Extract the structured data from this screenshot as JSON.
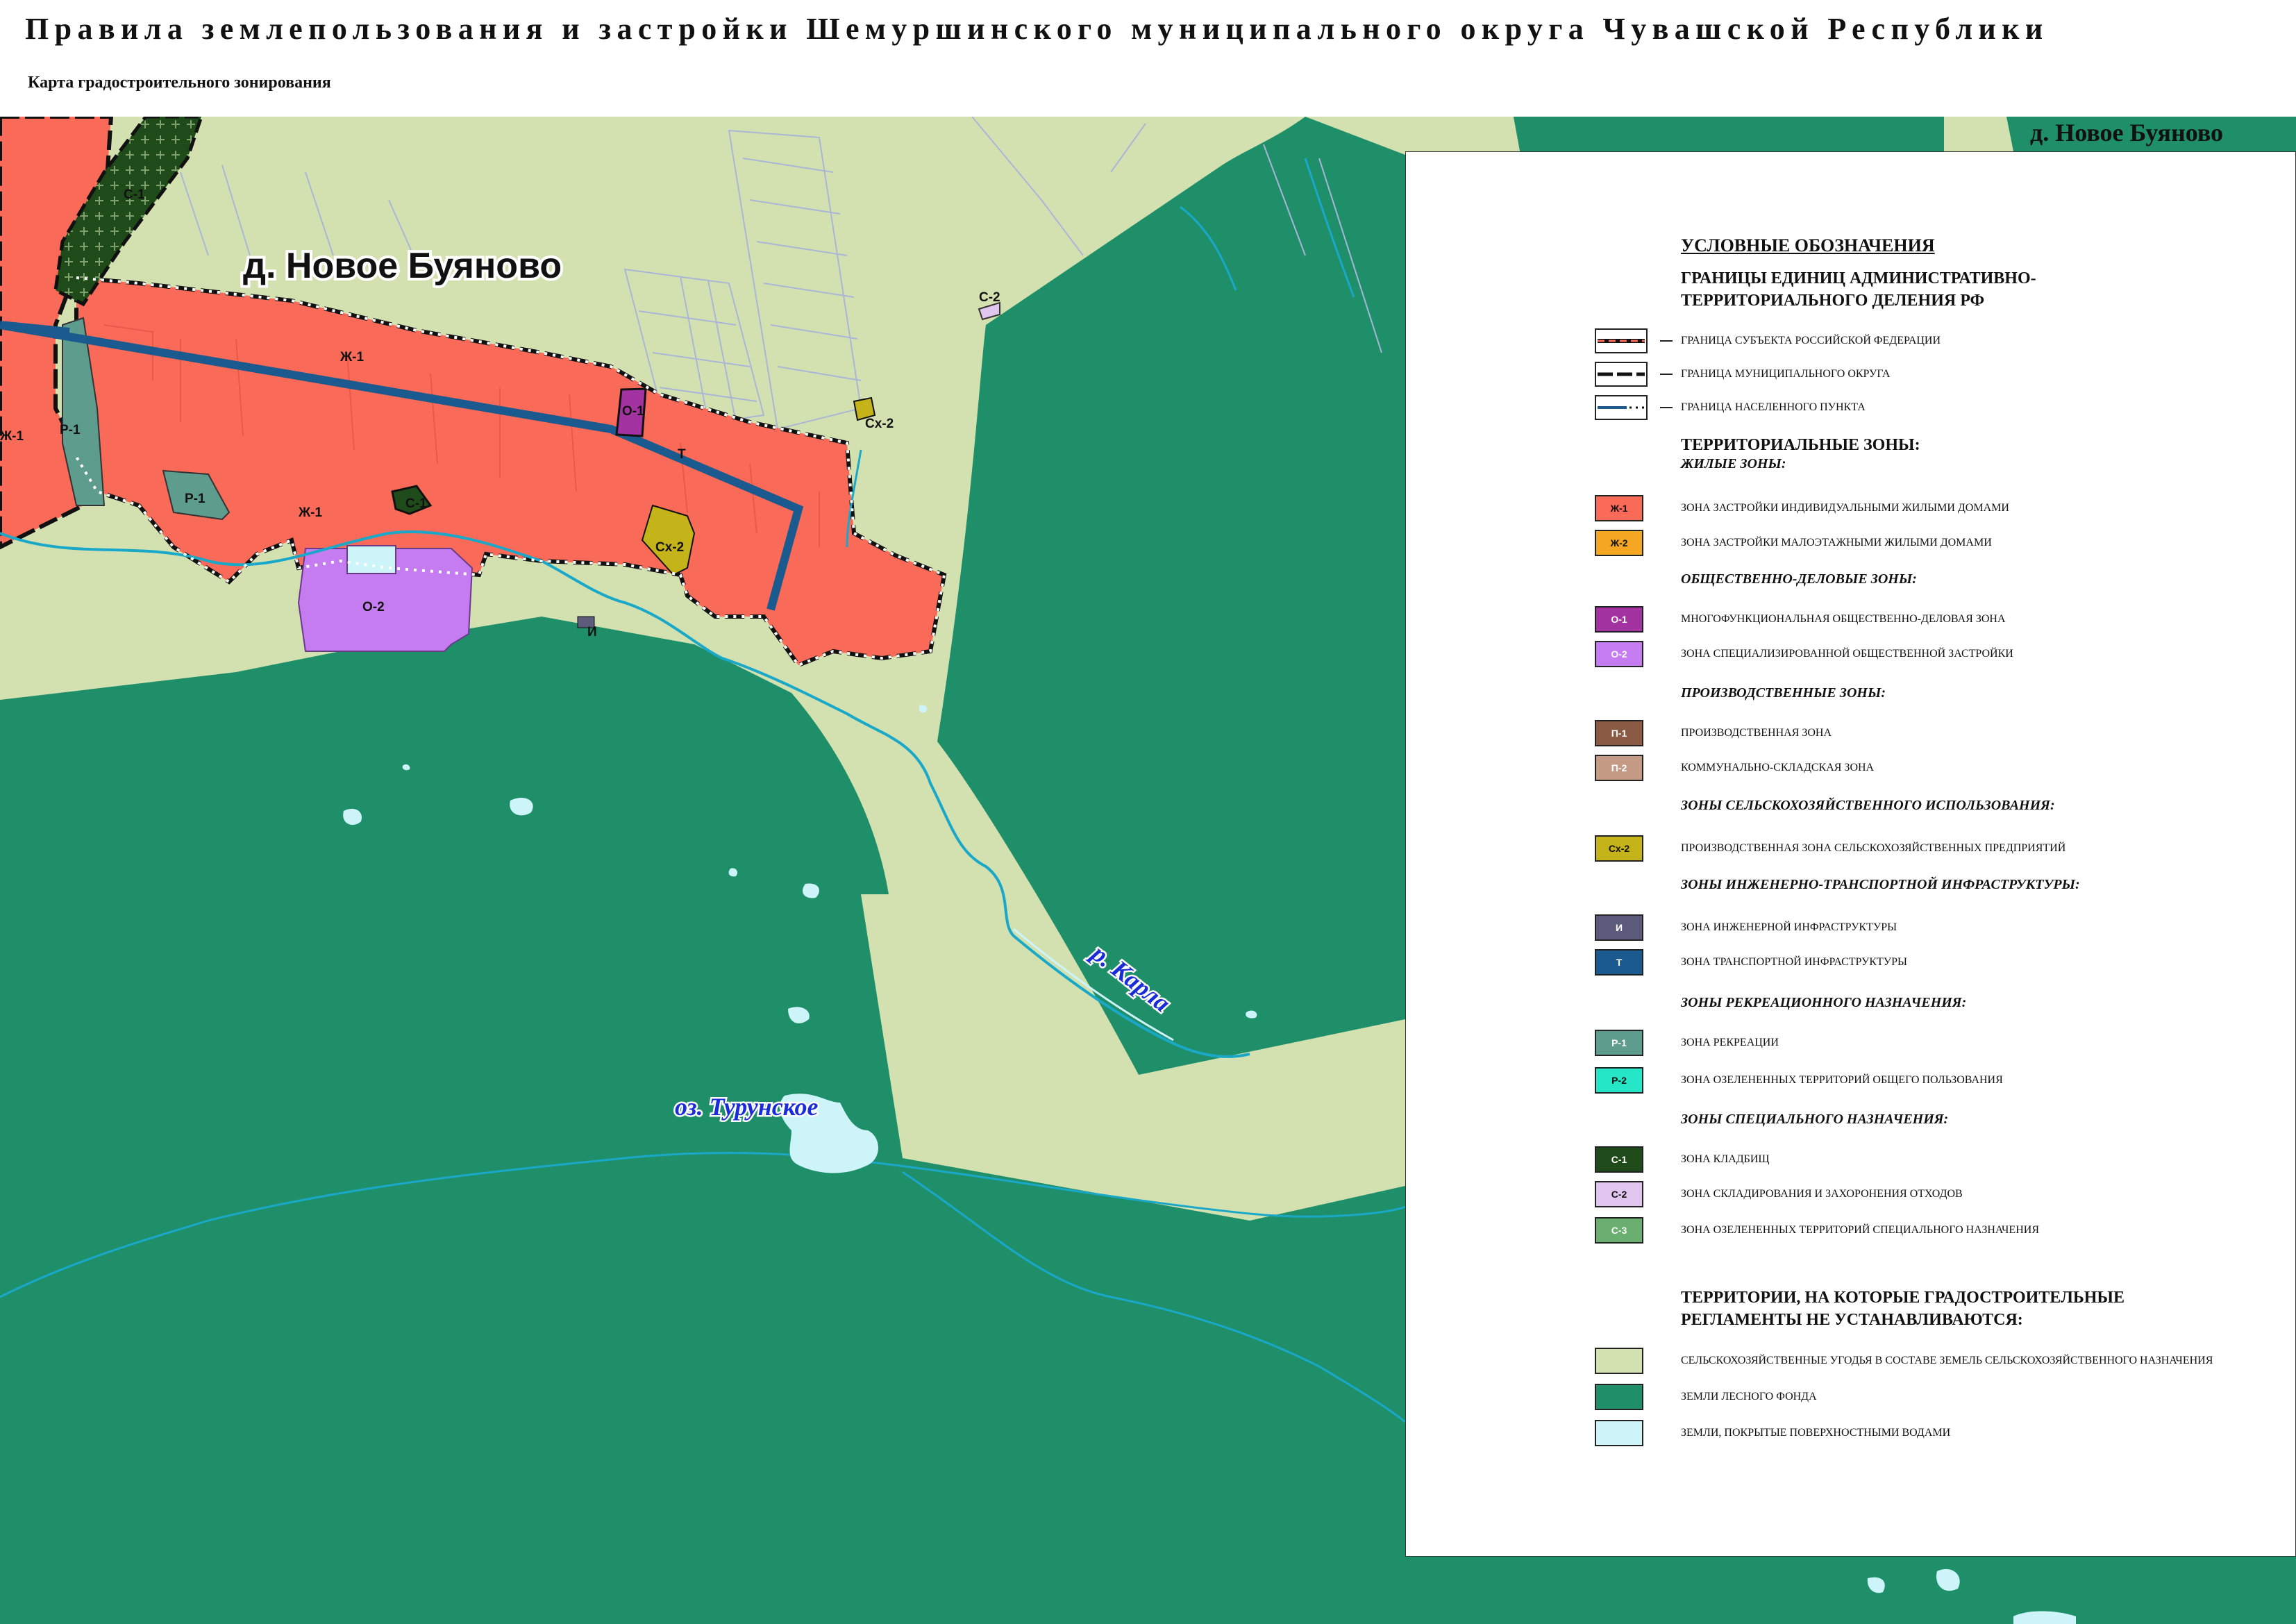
{
  "header": {
    "title": "Правила землепользования и застройки Шемуршинского муниципального округа Чувашской Республики",
    "subtitle": "Карта градостроительного зонирования"
  },
  "map": {
    "place_name": "д. Новое Буяново",
    "corner_place_name": "д. Новое Буяново",
    "river_label": "р. Карла",
    "lake_label": "оз. Турунское",
    "zone_labels": {
      "zh1_a": "Ж-1",
      "zh1_b": "Ж-1",
      "zh1_c": "Ж-1",
      "s1_a": "С-1",
      "s1_b": "С-1",
      "r1_a": "Р-1",
      "r1_b": "Р-1",
      "o1": "О-1",
      "o2": "О-2",
      "t": "Т",
      "i": "И",
      "sx2_a": "Сх-2",
      "sx2_b": "Сх-2",
      "s2": "С-2"
    },
    "colors": {
      "residential": "#f96a58",
      "forest": "#1f8f6a",
      "agri": "#d3e1b1",
      "water": "#cdf5f9",
      "transport": "#1a5a8e",
      "river": "#1aa8c8"
    }
  },
  "legend": {
    "title": "УСЛОВНЫЕ ОБОЗНАЧЕНИЯ",
    "boundaries_heading": "ГРАНИЦЫ ЕДИНИЦ АДМИНИСТРАТИВНО-\nТЕРРИТОРИАЛЬНОГО ДЕЛЕНИЯ РФ",
    "boundaries": [
      {
        "label": "ГРАНИЦА СУБЪЕКТА РОССИЙСКОЙ ФЕДЕРАЦИИ"
      },
      {
        "label": "ГРАНИЦА МУНИЦИПАЛЬНОГО ОКРУГА"
      },
      {
        "label": "ГРАНИЦА НАСЕЛЕННОГО ПУНКТА"
      }
    ],
    "zones_heading": "ТЕРРИТОРИАЛЬНЫЕ ЗОНЫ:",
    "groups": [
      {
        "heading": "ЖИЛЫЕ ЗОНЫ:",
        "items": [
          {
            "code": "Ж-1",
            "label": "ЗОНА ЗАСТРОЙКИ ИНДИВИДУАЛЬНЫМИ ЖИЛЫМИ ДОМАМИ",
            "color": "#f96a58",
            "text_color": "#111111"
          },
          {
            "code": "Ж-2",
            "label": "ЗОНА ЗАСТРОЙКИ МАЛОЭТАЖНЫМИ ЖИЛЫМИ ДОМАМИ",
            "color": "#f5a623",
            "text_color": "#111111"
          }
        ]
      },
      {
        "heading": "ОБЩЕСТВЕННО-ДЕЛОВЫЕ ЗОНЫ:",
        "items": [
          {
            "code": "О-1",
            "label": "МНОГОФУНКЦИОНАЛЬНАЯ ОБЩЕСТВЕННО-ДЕЛОВАЯ ЗОНА",
            "color": "#a233a0",
            "text_color": "#ffffff"
          },
          {
            "code": "О-2",
            "label": "ЗОНА СПЕЦИАЛИЗИРОВАННОЙ ОБЩЕСТВЕННОЙ ЗАСТРОЙКИ",
            "color": "#c57cf0",
            "text_color": "#ffffff"
          }
        ]
      },
      {
        "heading": "ПРОИЗВОДСТВЕННЫЕ ЗОНЫ:",
        "items": [
          {
            "code": "П-1",
            "label": "ПРОИЗВОДСТВЕННАЯ ЗОНА",
            "color": "#8b5a44",
            "text_color": "#ffffff"
          },
          {
            "code": "П-2",
            "label": "КОММУНАЛЬНО-СКЛАДСКАЯ ЗОНА",
            "color": "#c49a85",
            "text_color": "#ffffff"
          }
        ]
      },
      {
        "heading": "ЗОНЫ СЕЛЬСКОХОЗЯЙСТВЕННОГО ИСПОЛЬЗОВАНИЯ:",
        "items": [
          {
            "code": "Сх-2",
            "label": "ПРОИЗВОДСТВЕННАЯ ЗОНА СЕЛЬСКОХОЗЯЙСТВЕННЫХ ПРЕДПРИЯТИЙ",
            "color": "#c4b41a",
            "text_color": "#111111"
          }
        ]
      },
      {
        "heading": "ЗОНЫ ИНЖЕНЕРНО-ТРАНСПОРТНОЙ ИНФРАСТРУКТУРЫ:",
        "items": [
          {
            "code": "И",
            "label": "ЗОНА ИНЖЕНЕРНОЙ ИНФРАСТРУКТУРЫ",
            "color": "#5c5b7c",
            "text_color": "#ffffff"
          },
          {
            "code": "Т",
            "label": "ЗОНА ТРАНСПОРТНОЙ ИНФРАСТРУКТУРЫ",
            "color": "#1a5a8e",
            "text_color": "#ffffff"
          }
        ]
      },
      {
        "heading": "ЗОНЫ РЕКРЕАЦИОННОГО НАЗНАЧЕНИЯ:",
        "items": [
          {
            "code": "Р-1",
            "label": "ЗОНА РЕКРЕАЦИИ",
            "color": "#5e9c8e",
            "text_color": "#ffffff"
          },
          {
            "code": "Р-2",
            "label": "ЗОНА ОЗЕЛЕНЕННЫХ ТЕРРИТОРИЙ ОБЩЕГО ПОЛЬЗОВАНИЯ",
            "color": "#26e6c8",
            "text_color": "#111111"
          }
        ]
      },
      {
        "heading": "ЗОНЫ СПЕЦИАЛЬНОГО НАЗНАЧЕНИЯ:",
        "items": [
          {
            "code": "С-1",
            "label": "ЗОНА КЛАДБИЩ",
            "color": "#1f4a1a",
            "text_color": "#ffffff"
          },
          {
            "code": "С-2",
            "label": "ЗОНА СКЛАДИРОВАНИЯ И ЗАХОРОНЕНИЯ ОТХОДОВ",
            "color": "#e0c6ee",
            "text_color": "#111111"
          },
          {
            "code": "С-3",
            "label": "ЗОНА ОЗЕЛЕНЕННЫХ ТЕРРИТОРИЙ СПЕЦИАЛЬНОГО НАЗНАЧЕНИЯ",
            "color": "#6aae70",
            "text_color": "#ffffff"
          }
        ]
      }
    ],
    "no_regulation_heading": "ТЕРРИТОРИИ, НА КОТОРЫЕ ГРАДОСТРОИТЕЛЬНЫЕ\nРЕГЛАМЕНТЫ НЕ УСТАНАВЛИВАЮТСЯ:",
    "no_regulation_items": [
      {
        "label": "СЕЛЬСКОХОЗЯЙСТВЕННЫЕ УГОДЬЯ В СОСТАВЕ ЗЕМЕЛЬ СЕЛЬСКОХОЗЯЙСТВЕННОГО НАЗНАЧЕНИЯ",
        "color": "#d3e1b1"
      },
      {
        "label": "ЗЕМЛИ ЛЕСНОГО ФОНДА",
        "color": "#1f8f6a"
      },
      {
        "label": "ЗЕМЛИ, ПОКРЫТЫЕ ПОВЕРХНОСТНЫМИ ВОДАМИ",
        "color": "#cdf5f9"
      }
    ]
  }
}
